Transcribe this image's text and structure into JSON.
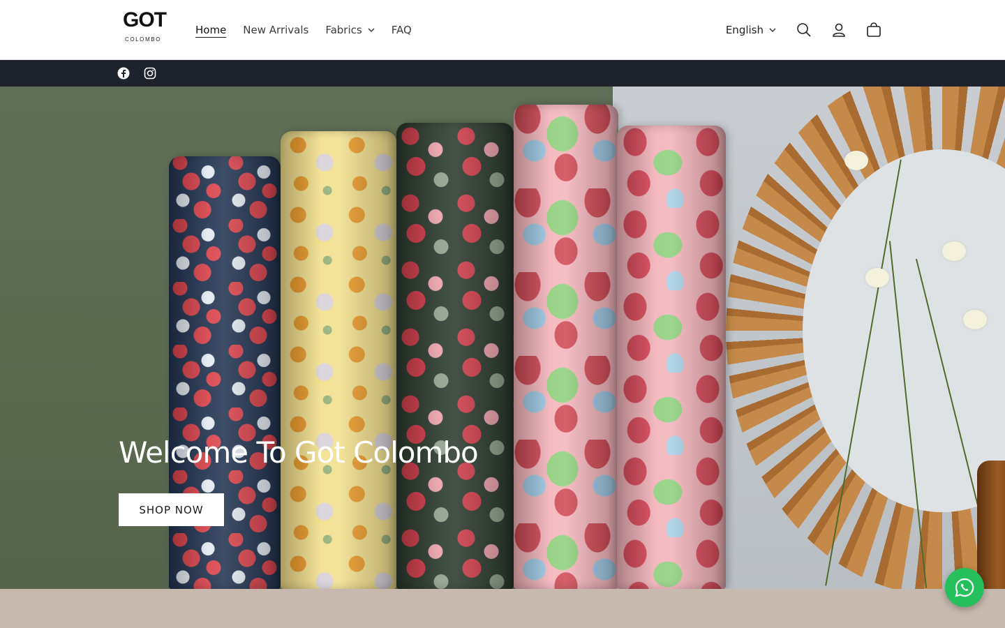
{
  "logo": {
    "mark": "GOT",
    "sub": "COLOMBO"
  },
  "nav": [
    {
      "label": "Home",
      "active": true
    },
    {
      "label": "New Arrivals"
    },
    {
      "label": "Fabrics",
      "dropdown": true
    },
    {
      "label": "FAQ"
    }
  ],
  "header": {
    "language": "English"
  },
  "social": {
    "facebook": "facebook-icon",
    "instagram": "instagram-icon"
  },
  "hero": {
    "title": "Welcome To Got Colombo",
    "button": "SHOP NOW"
  },
  "colors": {
    "header_bg": "#ffffff",
    "social_bar_bg": "#1e232b",
    "footer_band": "#c8b9ae",
    "whatsapp": "#25c05b"
  }
}
